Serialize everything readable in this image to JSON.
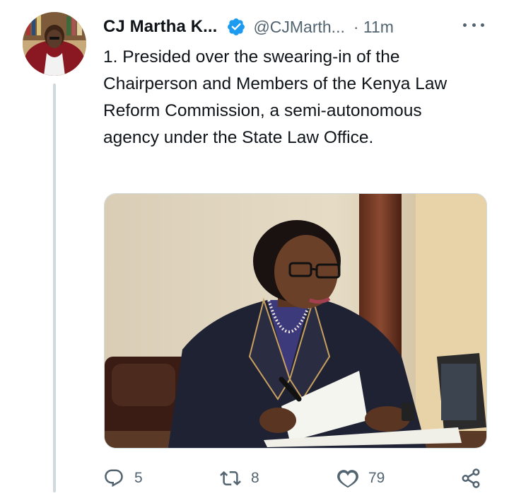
{
  "tweet": {
    "author_name": "CJ Martha K...",
    "handle": "@CJMarth...",
    "time": "· 11m",
    "text": "1. Presided over the swearing-in of the Chairperson and Members of the Kenya Law Reform Commission, a semi-autonomous agency under the State Law Office."
  },
  "icons": {
    "verified": "verified-badge-icon",
    "more": "more-options-icon",
    "reply": "reply-icon",
    "retweet": "retweet-icon",
    "like": "like-icon",
    "share": "share-icon"
  },
  "actions": {
    "replies": "5",
    "retweets": "8",
    "likes": "79"
  },
  "colors": {
    "verified": "#1d9bf0",
    "secondary_text": "#536471",
    "primary_text": "#0f1419",
    "thread_line": "#cfd9de"
  }
}
